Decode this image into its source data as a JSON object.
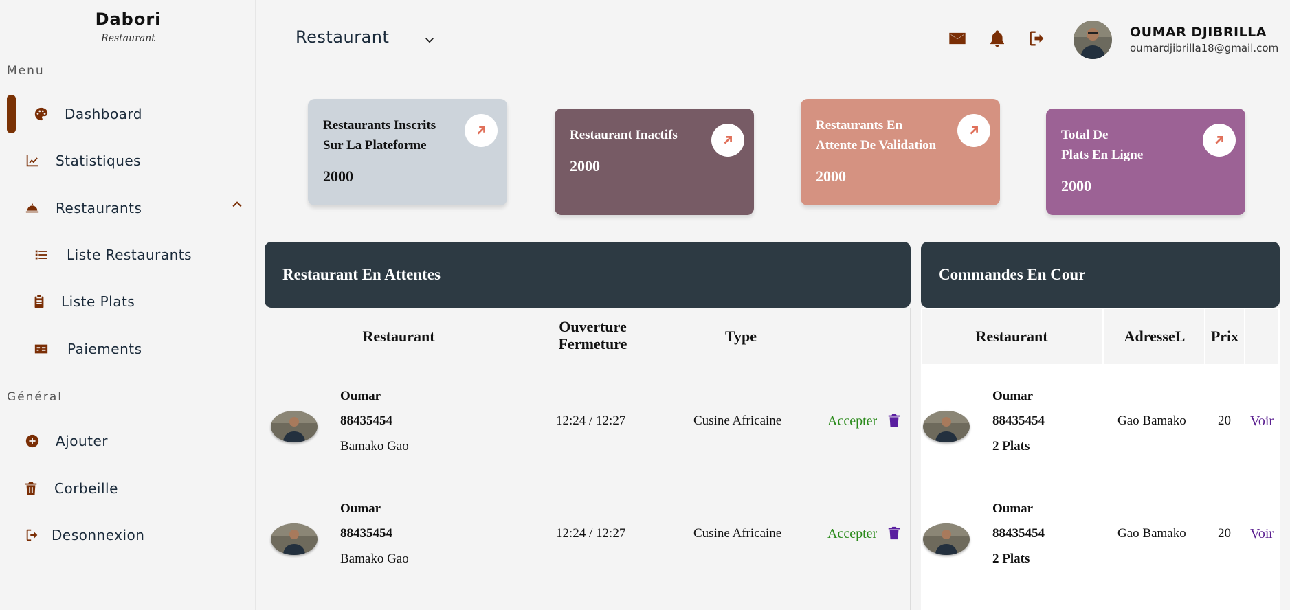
{
  "brand": {
    "name": "Dabori",
    "subtitle": "Restaurant"
  },
  "sidebar": {
    "menu_label": "Menu",
    "general_label": "Général",
    "items": [
      {
        "label": "Dashboard",
        "icon": "palette-icon"
      },
      {
        "label": "Statistiques",
        "icon": "chart-line-icon"
      },
      {
        "label": "Restaurants",
        "icon": "bell-concierge-icon"
      },
      {
        "label": "Liste Restaurants",
        "icon": "list-icon"
      },
      {
        "label": "Liste Plats",
        "icon": "clipboard-icon"
      },
      {
        "label": "Paiements",
        "icon": "money-card-icon"
      },
      {
        "label": "Ajouter",
        "icon": "plus-circle-icon"
      },
      {
        "label": "Corbeille",
        "icon": "trash-icon"
      },
      {
        "label": "Desonnexion",
        "icon": "sign-out-icon"
      }
    ]
  },
  "header": {
    "selected": "Restaurant",
    "user": {
      "name": "OUMAR DJIBRILLA",
      "email": "oumardjibrilla18@gmail.com"
    }
  },
  "cards": [
    {
      "title": "Restaurants Inscrits\nSur La Plateforme",
      "value": "2000",
      "bg": "#cdd4db",
      "fg": "#111111"
    },
    {
      "title": "Restaurant Inactifs",
      "value": "2000",
      "bg": "#775b65",
      "fg": "#ffffff"
    },
    {
      "title": "Restaurants En\nAttente De Validation",
      "value": "2000",
      "bg": "#d59281",
      "fg": "#ffffff"
    },
    {
      "title": "Total De\nPlats En Ligne",
      "value": "2000",
      "bg": "#9c6295",
      "fg": "#ffffff"
    }
  ],
  "pending": {
    "title": "Restaurant En Attentes",
    "columns": [
      "Restaurant",
      "Ouverture\nFermeture",
      "Type"
    ],
    "rows": [
      {
        "name": "Oumar",
        "phone": "88435454",
        "city": "Bamako Gao",
        "hours": "12:24 / 12:27",
        "type": "Cusine Africaine",
        "action": "Accepter"
      },
      {
        "name": "Oumar",
        "phone": "88435454",
        "city": "Bamako Gao",
        "hours": "12:24 / 12:27",
        "type": "Cusine Africaine",
        "action": "Accepter"
      }
    ]
  },
  "orders": {
    "title": "Commandes En Cour",
    "columns": [
      "Restaurant",
      "AdresseL",
      "Prix"
    ],
    "rows": [
      {
        "name": "Oumar",
        "phone": "88435454",
        "plats": "2 Plats",
        "address": "Gao Bamako",
        "price": "20",
        "action": "Voir"
      },
      {
        "name": "Oumar",
        "phone": "88435454",
        "plats": "2 Plats",
        "address": "Gao Bamako",
        "price": "20",
        "action": "Voir"
      }
    ]
  },
  "colors": {
    "accent": "#7a2e05",
    "panel": "#2d3a43",
    "accept": "#2a8a1a",
    "link": "#5a1f90"
  }
}
